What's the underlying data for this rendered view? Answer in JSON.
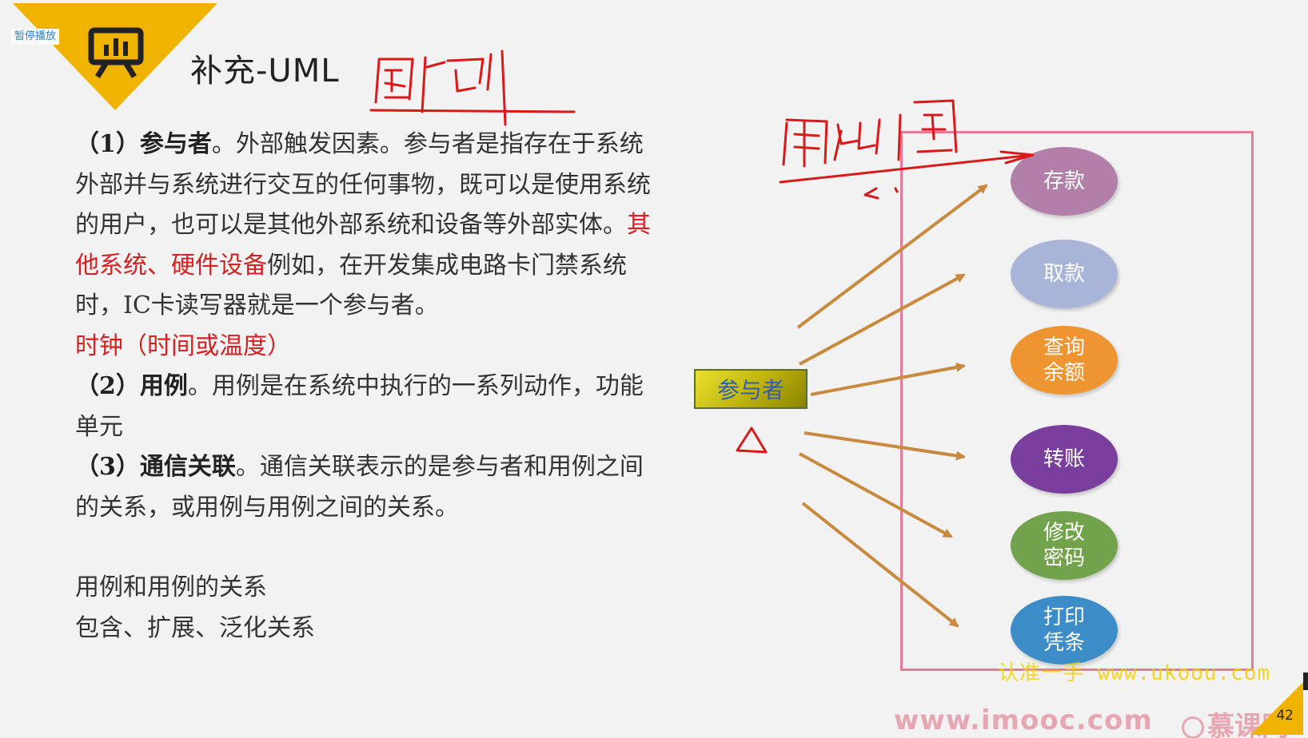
{
  "player": {
    "pause_label": "暂停播放"
  },
  "slide": {
    "title": "补充-UML",
    "page_number": "42",
    "paragraphs": {
      "p1_num": "（1）",
      "p1_bold": "参与者",
      "p1_a": "。外部触发因素。参与者是指存在于系统外部并与系统进行交互的任何事物，既可以是使用系统的用户，也可以是其他外部系统和设备等外部实体。",
      "p1_red": "其他系统、硬件设备",
      "p1_b": "例如，在开发集成电路卡门禁系统时，IC卡读写器就是一个参与者。",
      "p1_red2": "时钟（时间或温度）",
      "p2_num": "（2）",
      "p2_bold": "用例",
      "p2_a": "。用例是在系统中执行的一系列动作，功能单元",
      "p3_num": "（3）",
      "p3_bold": "通信关联",
      "p3_a": "。通信关联表示的是参与者和用例之间的关系，或用例与用例之间的关系。",
      "p4_line1": "用例和用例的关系",
      "p4_line2": "包含、扩展、泛化关系"
    }
  },
  "diagram": {
    "actor_label": "参与者",
    "usecases": [
      {
        "id": "deposit",
        "line1": "存款",
        "line2": "",
        "color": "#b27fa8"
      },
      {
        "id": "withdraw",
        "line1": "取款",
        "line2": "",
        "color": "#a9b5d8"
      },
      {
        "id": "balance",
        "line1": "查询",
        "line2": "余额",
        "color": "#ee9430"
      },
      {
        "id": "transfer",
        "line1": "转账",
        "line2": "",
        "color": "#7a3f9c"
      },
      {
        "id": "password",
        "line1": "修改",
        "line2": "密码",
        "color": "#72a34c"
      },
      {
        "id": "receipt",
        "line1": "打印",
        "line2": "凭条",
        "color": "#3c8cc8"
      }
    ],
    "arrow_color": "#c88a3e",
    "box_color": "#e57b96",
    "accent_color": "#f0b400"
  },
  "watermarks": {
    "ukoou": "认准一手 www.ukoou.com",
    "imooc": "www.imooc.com",
    "brand": "慕课网"
  },
  "icons": {
    "presentation": "presentation-board-icon",
    "brand": "imooc-logo-icon"
  }
}
